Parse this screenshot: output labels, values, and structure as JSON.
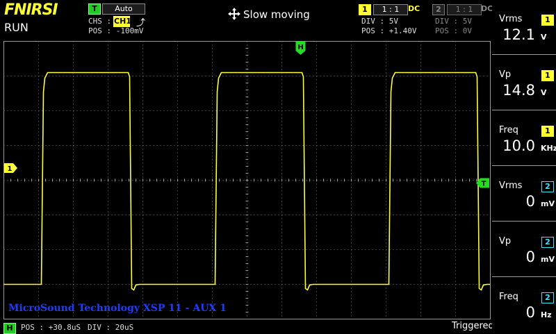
{
  "brand": "FNIRSI",
  "run_state": "RUN",
  "trigger": {
    "badge": "T",
    "mode": "Auto",
    "source_label": "CHS :",
    "source": "CH1",
    "edge_icon": "rising-edge-icon",
    "edge_glyph": "⤴",
    "pos_label": "POS : -100mV"
  },
  "move_mode": "Slow moving",
  "ch1": {
    "badge": "1",
    "probe": "1 : 1",
    "coupling": "DC",
    "div_label": "DIV :  5V",
    "pos_label": "POS : +1.40V",
    "marker": "1",
    "color": "#ffff33"
  },
  "ch2": {
    "badge": "2",
    "probe": "1 : 1",
    "coupling": "DC",
    "div_label": "DIV :  5V",
    "pos_label": "POS : 0V",
    "color": "#40e0ff"
  },
  "markers": {
    "h": "H",
    "t": "T"
  },
  "watermark": "MicroSound Technology XSP 11 - AUX 1",
  "timebase": {
    "badge": "H",
    "pos_label": "POS : +30.8uS",
    "div_label": "DIV : 20uS"
  },
  "trigger_status": "Triggered",
  "measurements": [
    {
      "label": "Vrms",
      "channel": "1",
      "value": "12.1",
      "unit": "V"
    },
    {
      "label": "Vp",
      "channel": "1",
      "value": "14.8",
      "unit": "V"
    },
    {
      "label": "Freq",
      "channel": "1",
      "value": "10.0",
      "unit": "KHz"
    },
    {
      "label": "Vrms",
      "channel": "2",
      "value": "0",
      "unit": "mV"
    },
    {
      "label": "Vp",
      "channel": "2",
      "value": "0",
      "unit": "mV"
    },
    {
      "label": "Freq",
      "channel": "2",
      "value": "0",
      "unit": "Hz"
    }
  ],
  "waveform": {
    "channel": "1",
    "shape": "square",
    "high_div": 3.1,
    "low_div": -3.0,
    "rise_times_div": [
      1.08,
      6.08,
      11.08
    ],
    "fall_times_div": [
      3.62,
      8.62,
      13.62
    ],
    "color": "#ffff33"
  },
  "grid": {
    "h_divs": 14,
    "v_divs": 8,
    "color": "#7a7a7a"
  }
}
